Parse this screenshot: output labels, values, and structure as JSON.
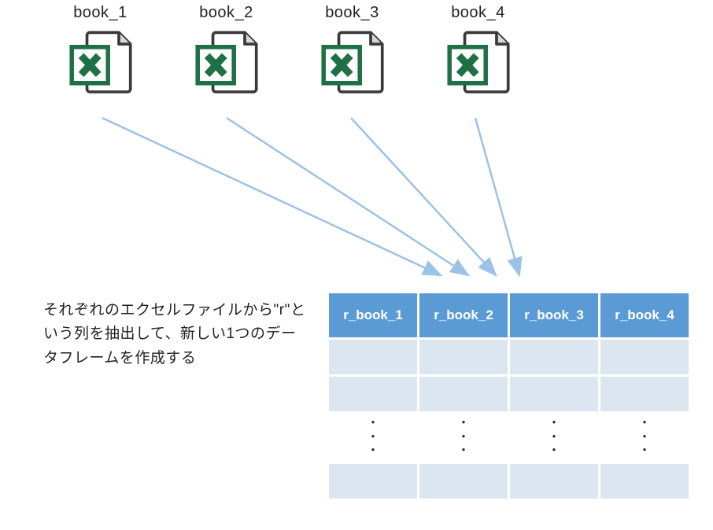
{
  "files": [
    {
      "label": "book_1"
    },
    {
      "label": "book_2"
    },
    {
      "label": "book_3"
    },
    {
      "label": "book_4"
    }
  ],
  "description": "それぞれのエクセルファイルから\"r\"という列を抽出して、新しい1つのデータフレームを作成する",
  "table": {
    "headers": [
      "r_book_1",
      "r_book_2",
      "r_book_3",
      "r_book_4"
    ]
  },
  "dots": "・\n・\n・"
}
